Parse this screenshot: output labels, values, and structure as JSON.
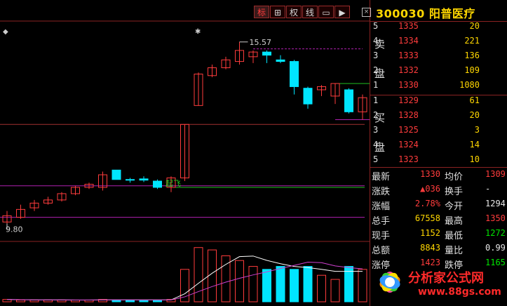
{
  "toolbar": {
    "buttons": [
      {
        "label": "标",
        "icon": "mark"
      },
      {
        "label": "⊞",
        "icon": "grid-icon"
      },
      {
        "label": "权",
        "icon": "rights"
      },
      {
        "label": "线",
        "icon": "line"
      },
      {
        "label": "▭",
        "icon": "window-icon"
      },
      {
        "label": "▶",
        "icon": "play-icon"
      }
    ]
  },
  "quote": {
    "code": "300030",
    "name": "阳普医疗",
    "close_symbol": "×",
    "sell_label_1": "卖",
    "sell_label_2": "盘",
    "buy_label_1": "买",
    "buy_label_2": "盘",
    "sell": [
      {
        "level": "5",
        "price": "1335",
        "volume": "20"
      },
      {
        "level": "4",
        "price": "1334",
        "volume": "221"
      },
      {
        "level": "3",
        "price": "1333",
        "volume": "136"
      },
      {
        "level": "2",
        "price": "1332",
        "volume": "109"
      },
      {
        "level": "1",
        "price": "1330",
        "volume": "1080"
      }
    ],
    "buy": [
      {
        "level": "1",
        "price": "1329",
        "volume": "61"
      },
      {
        "level": "2",
        "price": "1328",
        "volume": "20"
      },
      {
        "level": "3",
        "price": "1325",
        "volume": "3"
      },
      {
        "level": "4",
        "price": "1324",
        "volume": "14"
      },
      {
        "level": "5",
        "price": "1323",
        "volume": "10"
      }
    ],
    "stats": [
      {
        "l1": "最新",
        "v1": "1330",
        "c1": "red",
        "l2": "均价",
        "v2": "1309",
        "c2": "red"
      },
      {
        "l1": "涨跌",
        "v1": "▲036",
        "c1": "red",
        "l2": "换手",
        "v2": "-",
        "c2": "wht"
      },
      {
        "l1": "涨幅",
        "v1": "2.78%",
        "c1": "red",
        "l2": "今开",
        "v2": "1294",
        "c2": "wht"
      },
      {
        "l1": "总手",
        "v1": "67558",
        "c1": "yel",
        "l2": "最高",
        "v2": "1350",
        "c2": "red"
      },
      {
        "l1": "现手",
        "v1": "1152",
        "c1": "yel",
        "l2": "最低",
        "v2": "1272",
        "c2": "grn"
      },
      {
        "l1": "总额",
        "v1": "8843",
        "c1": "yel",
        "l2": "量比",
        "v2": "0.99",
        "c2": "wht"
      },
      {
        "l1": "涨停",
        "v1": "1423",
        "c1": "red",
        "l2": "跌停",
        "v2": "1165",
        "c2": "grn"
      }
    ]
  },
  "chart": {
    "high_label": "15.57",
    "low_label": "9.80",
    "annotation": "起飞",
    "colors": {
      "up": "#ff3c3c",
      "down": "#00e5ff",
      "ma_white": "#ffffff",
      "ma_magenta": "#d040d0"
    }
  },
  "chart_data": {
    "type": "candlestick",
    "ylim": [
      9.5,
      16.1
    ],
    "candles": [
      {
        "o": 9.85,
        "c": 10.05,
        "h": 10.2,
        "l": 9.8
      },
      {
        "o": 10.0,
        "c": 10.25,
        "h": 10.4,
        "l": 9.95
      },
      {
        "o": 10.3,
        "c": 10.45,
        "h": 10.55,
        "l": 10.2
      },
      {
        "o": 10.45,
        "c": 10.55,
        "h": 10.65,
        "l": 10.4
      },
      {
        "o": 10.55,
        "c": 10.75,
        "h": 10.8,
        "l": 10.5
      },
      {
        "o": 10.75,
        "c": 10.95,
        "h": 11.0,
        "l": 10.7
      },
      {
        "o": 10.95,
        "c": 11.05,
        "h": 11.1,
        "l": 10.9
      },
      {
        "o": 10.95,
        "c": 11.35,
        "h": 11.45,
        "l": 10.85
      },
      {
        "o": 11.5,
        "c": 11.2,
        "h": 11.5,
        "l": 11.2
      },
      {
        "o": 11.2,
        "c": 11.18,
        "h": 11.25,
        "l": 11.1
      },
      {
        "o": 11.22,
        "c": 11.18,
        "h": 11.3,
        "l": 11.12
      },
      {
        "o": 11.15,
        "c": 10.95,
        "h": 11.2,
        "l": 10.9
      },
      {
        "o": 10.95,
        "c": 11.25,
        "h": 11.3,
        "l": 10.8
      },
      {
        "o": 11.25,
        "c": 12.95,
        "h": 12.95,
        "l": 11.15
      },
      {
        "o": 13.55,
        "c": 14.55,
        "h": 14.6,
        "l": 13.55
      },
      {
        "o": 14.5,
        "c": 14.75,
        "h": 14.85,
        "l": 14.45
      },
      {
        "o": 14.75,
        "c": 15.0,
        "h": 15.1,
        "l": 14.7
      },
      {
        "o": 14.95,
        "c": 15.3,
        "h": 15.57,
        "l": 14.85
      },
      {
        "o": 15.1,
        "c": 15.25,
        "h": 15.3,
        "l": 14.9
      },
      {
        "o": 15.25,
        "c": 15.15,
        "h": 15.3,
        "l": 14.9
      },
      {
        "o": 15.0,
        "c": 14.95,
        "h": 15.15,
        "l": 14.9
      },
      {
        "o": 14.95,
        "c": 14.15,
        "h": 15.0,
        "l": 13.9
      },
      {
        "o": 14.1,
        "c": 13.6,
        "h": 14.15,
        "l": 13.45
      },
      {
        "o": 14.05,
        "c": 14.15,
        "h": 14.2,
        "l": 13.85
      },
      {
        "o": 13.85,
        "c": 14.25,
        "h": 14.25,
        "l": 13.6
      },
      {
        "o": 14.05,
        "c": 13.35,
        "h": 14.1,
        "l": 13.3
      },
      {
        "o": 13.35,
        "c": 13.8,
        "h": 13.9,
        "l": 13.1
      }
    ],
    "volume_ylim": [
      0,
      100
    ],
    "volumes": [
      4,
      3,
      3,
      3,
      3,
      3,
      3,
      4,
      3,
      3,
      3,
      3,
      4,
      55,
      92,
      88,
      78,
      70,
      60,
      55,
      60,
      55,
      60,
      45,
      38,
      60,
      55
    ],
    "levels": [
      {
        "value": 12.95,
        "color": "#a03030"
      },
      {
        "value": 11.0,
        "color": "#b020b0"
      },
      {
        "value": 10.0,
        "color": "#b020b0"
      },
      {
        "value": 10.95,
        "color": "#20c020",
        "from": 12
      }
    ]
  }
}
